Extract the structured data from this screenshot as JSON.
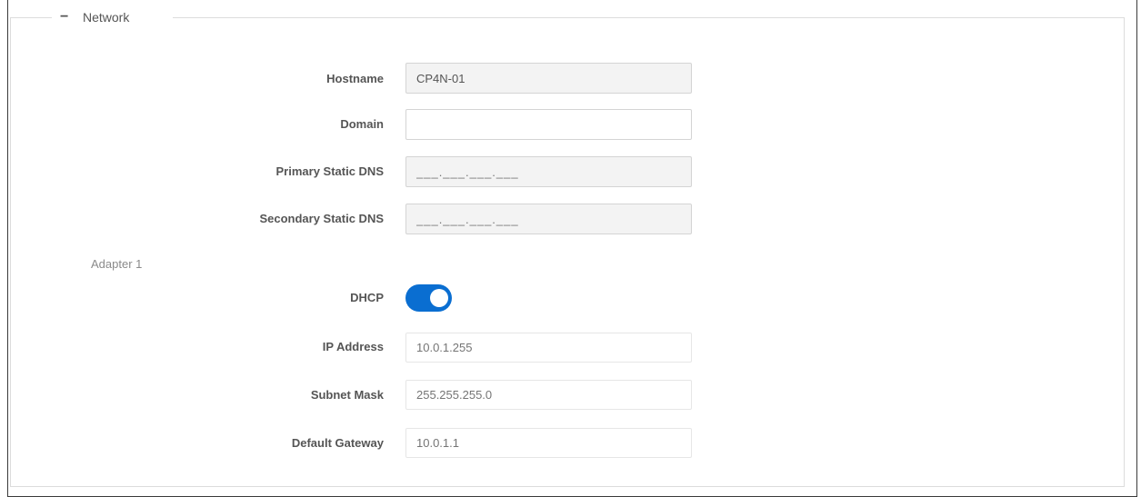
{
  "section": {
    "collapse_glyph": "−",
    "title": "Network"
  },
  "general": {
    "hostname": {
      "label": "Hostname",
      "value": "CP4N-01"
    },
    "domain": {
      "label": "Domain",
      "value": ""
    },
    "primary_dns": {
      "label": "Primary Static DNS",
      "placeholder": "___.___.___.___"
    },
    "secondary_dns": {
      "label": "Secondary Static DNS",
      "placeholder": "___.___.___.___"
    }
  },
  "adapter": {
    "title": "Adapter 1",
    "dhcp": {
      "label": "DHCP",
      "enabled": true
    },
    "ip_address": {
      "label": "IP Address",
      "placeholder": "10.0.1.255"
    },
    "subnet_mask": {
      "label": "Subnet Mask",
      "placeholder": "255.255.255.0"
    },
    "default_gateway": {
      "label": "Default Gateway",
      "placeholder": "10.0.1.1"
    }
  },
  "colors": {
    "toggle_on": "#0a6ed1",
    "border": "#dcdcdc"
  }
}
